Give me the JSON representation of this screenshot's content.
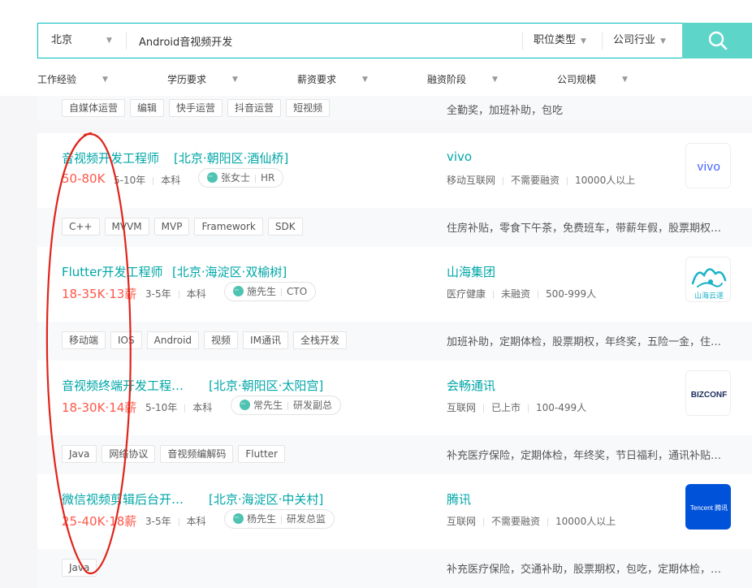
{
  "search": {
    "city": "北京",
    "query": "Android音视频开发",
    "position_type": "职位类型",
    "industry": "公司行业"
  },
  "filters": [
    "工作经验",
    "学历要求",
    "薪资要求",
    "融资阶段",
    "公司规模"
  ],
  "partial_card": {
    "tags": [
      "自媒体运营",
      "编辑",
      "快手运营",
      "抖音运营",
      "短视频"
    ],
    "welfare": "全勤奖，加班补助，包吃"
  },
  "jobs": [
    {
      "title": "音视频开发工程师",
      "area": "[北京·朝阳区·酒仙桥]",
      "salary": "50-80K",
      "experience": "5-10年",
      "education": "本科",
      "recruiter_name": "张女士",
      "recruiter_role": "HR",
      "company": "vivo",
      "company_industry": "移动互联网",
      "company_stage": "不需要融资",
      "company_size": "10000人以上",
      "logo": "vivo-logo",
      "tags": [
        "C++",
        "MVVM",
        "MVP",
        "Framework",
        "SDK"
      ],
      "welfare": "住房补贴，零食下午茶，免费班车，带薪年假，股票期权，节日福利"
    },
    {
      "title": "Flutter开发工程师",
      "area": "[北京·海淀区·双榆树]",
      "salary": "18-35K·13薪",
      "experience": "3-5年",
      "education": "本科",
      "recruiter_name": "施先生",
      "recruiter_role": "CTO",
      "company": "山海集团",
      "company_industry": "医疗健康",
      "company_stage": "未融资",
      "company_size": "500-999人",
      "logo": "shanhai-logo",
      "logo_text": "山海云遂",
      "tags": [
        "移动端",
        "IOS",
        "Android",
        "视频",
        "IM通讯",
        "全栈开发"
      ],
      "welfare": "加班补助，定期体检，股票期权，年终奖，五险一金，住房补贴"
    },
    {
      "title": "音视频终端开发工程…",
      "area": "[北京·朝阳区·太阳宫]",
      "salary": "18-30K·14薪",
      "experience": "5-10年",
      "education": "本科",
      "recruiter_name": "常先生",
      "recruiter_role": "研发副总",
      "company": "会畅通讯",
      "company_industry": "互联网",
      "company_stage": "已上市",
      "company_size": "100-499人",
      "logo": "bizconf-logo",
      "logo_text": "BIZCONF",
      "tags": [
        "Java",
        "网络协议",
        "音视频编解码",
        "Flutter"
      ],
      "welfare": "补充医疗保险，定期体检，年终奖，节日福利，通讯补贴，零食下午茶"
    },
    {
      "title": "微信视频剪辑后台开…",
      "area": "[北京·海淀区·中关村]",
      "salary": "25-40K·18薪",
      "experience": "3-5年",
      "education": "本科",
      "recruiter_name": "杨先生",
      "recruiter_role": "研发总监",
      "company": "腾讯",
      "company_industry": "互联网",
      "company_stage": "不需要融资",
      "company_size": "10000人以上",
      "logo": "tencent-logo",
      "logo_text": "Tencent 腾讯",
      "tags": [
        "Java"
      ],
      "welfare": "补充医疗保险，交通补助，股票期权，包吃，定期体检，年终奖"
    }
  ],
  "colors": {
    "accent": "#00a6a7",
    "salary": "#fe574a",
    "search_button": "#5dd5c8",
    "annotation": "#e0241b"
  }
}
